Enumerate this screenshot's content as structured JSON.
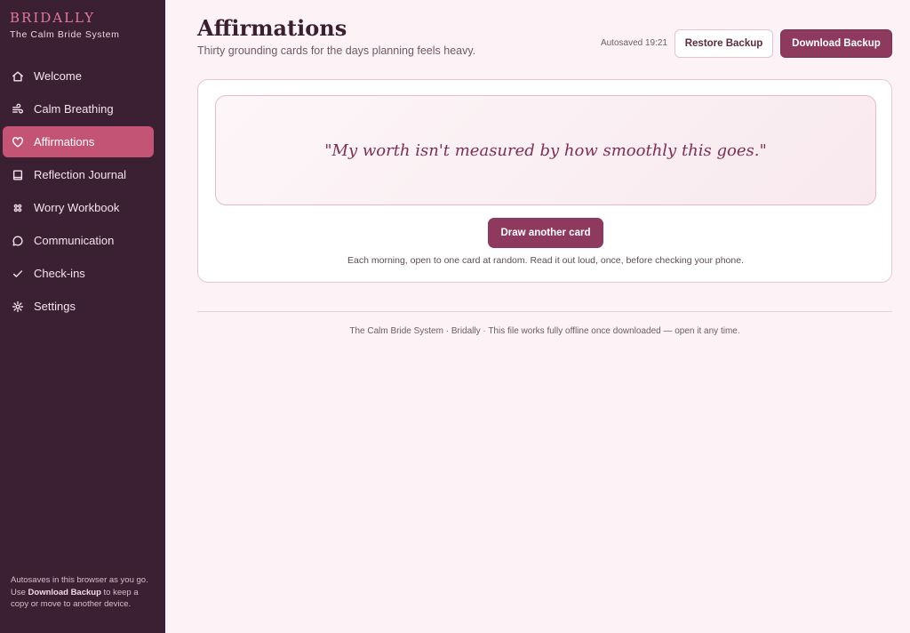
{
  "brand": {
    "name": "BRIDALLY",
    "tagline": "The Calm Bride System"
  },
  "sidebar": {
    "items": [
      {
        "label": "Welcome",
        "icon": "home-icon"
      },
      {
        "label": "Calm Breathing",
        "icon": "wind-icon"
      },
      {
        "label": "Affirmations",
        "icon": "heart-icon",
        "active": true
      },
      {
        "label": "Reflection Journal",
        "icon": "book-icon"
      },
      {
        "label": "Worry Workbook",
        "icon": "knot-icon"
      },
      {
        "label": "Communication",
        "icon": "chat-bubble-icon"
      },
      {
        "label": "Check-ins",
        "icon": "check-icon"
      },
      {
        "label": "Settings",
        "icon": "gear-icon"
      }
    ],
    "note_line1": "Autosaves in this browser as you go.",
    "note_use": "Use",
    "note_bold": "Download Backup",
    "note_rest": "to keep a copy or move to another device."
  },
  "header": {
    "title": "Affirmations",
    "subtitle": "Thirty grounding cards for the days planning feels heavy.",
    "autosave": "Autosaved 19:21",
    "restore_label": "Restore Backup",
    "download_label": "Download Backup"
  },
  "card": {
    "quote": "\"My worth isn't measured by how smoothly this goes.\"",
    "draw_label": "Draw another card",
    "note": "Each morning, open to one card at random. Read it out loud, once, before checking your phone."
  },
  "footer": "The Calm Bride System · Bridally · This file works fully offline once downloaded — open it any time.",
  "colors": {
    "sidebar_bg": "#3b1f33",
    "accent": "#c45476",
    "primary_button": "#8e3a5e",
    "page_bg": "#fdf2f6"
  }
}
